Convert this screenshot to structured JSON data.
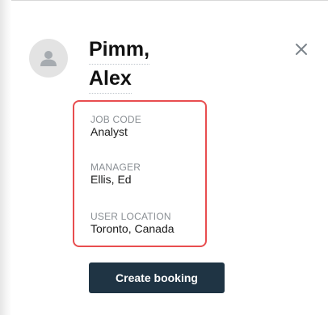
{
  "profile": {
    "last_name": "Pimm,",
    "first_name": "Alex"
  },
  "fields": [
    {
      "label": "JOB CODE",
      "value": "Analyst"
    },
    {
      "label": "MANAGER",
      "value": "Ellis, Ed"
    },
    {
      "label": "USER LOCATION",
      "value": "Toronto, Canada"
    }
  ],
  "actions": {
    "create_booking": "Create booking"
  },
  "icons": {
    "avatar": "user-silhouette-icon",
    "close": "close-icon"
  },
  "colors": {
    "highlight_border": "#e84d4f",
    "button_bg": "#1f3444",
    "avatar_bg": "#e3e3e3"
  }
}
